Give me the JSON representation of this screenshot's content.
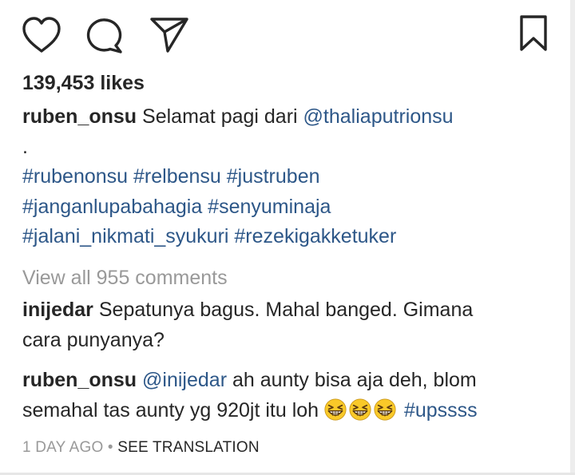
{
  "post": {
    "likes": "139,453 likes",
    "caption": {
      "username": "ruben_onsu",
      "text": "Selamat pagi dari",
      "mention": "@thaliaputrionsu",
      "dot": ".",
      "hashtag_lines": [
        "#rubenonsu #relbensu #justruben",
        "#janganlupabahagia #senyuminaja",
        "#jalani_nikmati_syukuri #rezekigakketuker"
      ]
    },
    "view_all_comments": "View all 955 comments",
    "comments": [
      {
        "username": "inijedar",
        "text_line1": "Sepatunya bagus. Mahal banged. Gimana",
        "text_line2": "cara punyanya?"
      },
      {
        "username": "ruben_onsu",
        "mention": "@inijedar",
        "text_line1": "ah aunty bisa aja deh, blom",
        "text_line2": "semahal tas aunty yg 920jt itu loh",
        "emoji_count": 3,
        "emoji_name": "grinning-squinting-face",
        "hashtag": "#upssss"
      }
    ],
    "timestamp": "1 DAY AGO",
    "separator": " • ",
    "see_translation": "SEE TRANSLATION"
  },
  "icons": [
    "heart-icon",
    "comment-icon",
    "share-icon",
    "bookmark-icon"
  ],
  "colors": {
    "text": "#262626",
    "link": "#2d5788",
    "muted": "#999999",
    "emoji": "#f9c929"
  }
}
